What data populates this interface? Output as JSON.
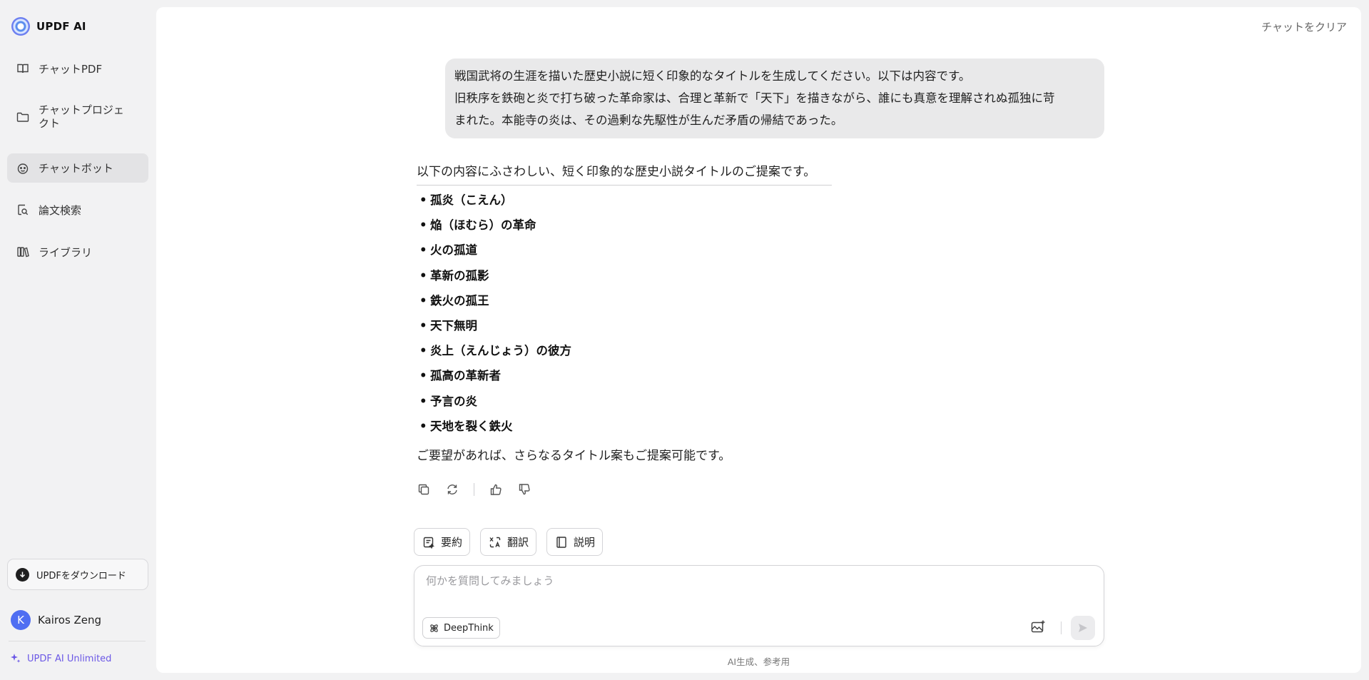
{
  "app": {
    "name": "UPDF AI"
  },
  "sidebar": {
    "items": [
      {
        "label": "チャットPDF",
        "icon": "book-open-icon"
      },
      {
        "label": "チャットプロジェクト",
        "icon": "folder-icon"
      },
      {
        "label": "チャットボット",
        "icon": "bot-icon",
        "active": true
      },
      {
        "label": "論文検索",
        "icon": "search-document-icon"
      },
      {
        "label": "ライブラリ",
        "icon": "library-icon"
      }
    ],
    "download_label": "UPDFをダウンロード",
    "user": {
      "initial": "K",
      "name": "Kairos Zeng"
    },
    "plan_label": "UPDF AI Unlimited"
  },
  "header": {
    "clear_label": "チャットをクリア"
  },
  "conversation": {
    "user_message": {
      "lines": [
        "戦国武将の生涯を描いた歴史小説に短く印象的なタイトルを生成してください。以下は内容です。",
        "旧秩序を鉄砲と炎で打ち破った革命家は、合理と革新で「天下」を描きながら、誰にも真意を理解されぬ孤独に苛",
        "まれた。本能寺の炎は、その過剰な先駆性が生んだ矛盾の帰結であった。"
      ]
    },
    "assistant_message": {
      "intro": "以下の内容にふさわしい、短く印象的な歴史小説タイトルのご提案です。",
      "titles": [
        "孤炎（こえん）",
        "焔（ほむら）の革命",
        "火の孤道",
        "革新の孤影",
        "鉄火の孤王",
        "天下無明",
        "炎上（えんじょう）の彼方",
        "孤高の革新者",
        "予言の炎",
        "天地を裂く鉄火"
      ],
      "outro": "ご要望があれば、さらなるタイトル案もご提案可能です。"
    }
  },
  "quick_actions": [
    {
      "label": "要約",
      "icon": "summary-icon"
    },
    {
      "label": "翻訳",
      "icon": "translate-icon"
    },
    {
      "label": "説明",
      "icon": "explain-book-icon"
    }
  ],
  "composer": {
    "placeholder": "何かを質問してみましょう",
    "deepthink_label": "DeepThink"
  },
  "footer_note": "AI生成、参考用",
  "colors": {
    "accent": "#6b58e6",
    "active_nav": "#e3e3e5",
    "avatar": "#4f6ef2"
  }
}
